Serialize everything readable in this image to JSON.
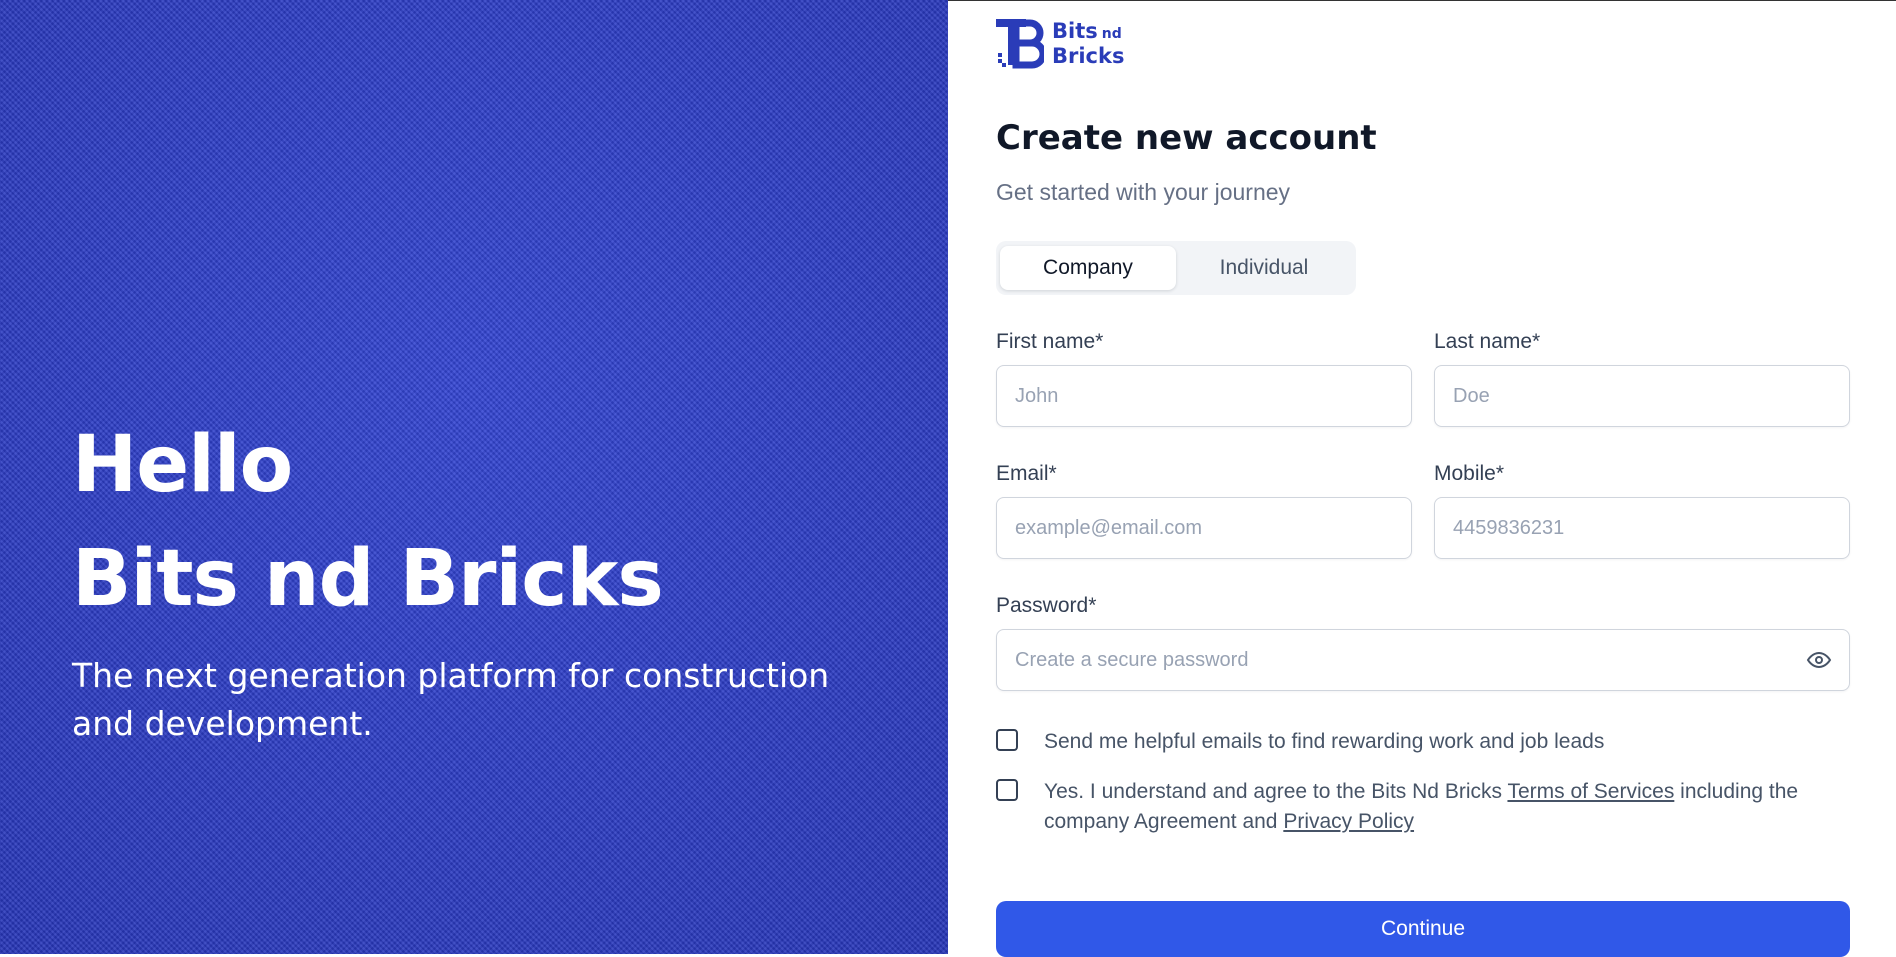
{
  "hero": {
    "title_line1": "Hello",
    "title_line2": "Bits nd Bricks",
    "subtitle": "The next generation platform for construction and development."
  },
  "logo": {
    "text_line1": "Bits",
    "text_nd": "nd",
    "text_line2": "Bricks",
    "icon": "bits-nd-bricks-logo"
  },
  "form": {
    "title": "Create new account",
    "subtitle": "Get started with your journey",
    "tabs": [
      {
        "label": "Company",
        "selected": true
      },
      {
        "label": "Individual",
        "selected": false
      }
    ],
    "first_name": {
      "label": "First name*",
      "placeholder": "John"
    },
    "last_name": {
      "label": "Last name*",
      "placeholder": "Doe"
    },
    "email": {
      "label": "Email*",
      "placeholder": "example@email.com"
    },
    "mobile": {
      "label": "Mobile*",
      "placeholder": "4459836231"
    },
    "password": {
      "label": "Password*",
      "placeholder": "Create a secure password",
      "toggle_icon": "eye-icon"
    },
    "opt_in": {
      "text": "Send me helpful emails to find rewarding work and job leads",
      "checked": false
    },
    "terms": {
      "text_before": "Yes. I understand and agree to the Bits Nd Bricks ",
      "terms_link": "Terms of Services",
      "text_middle": " including the company Agreement and ",
      "privacy_link": "Privacy Policy",
      "checked": false
    },
    "continue_label": "Continue"
  },
  "colors": {
    "hero_bg": "#2a3cc3",
    "primary": "#3058e8",
    "brand": "#2a3cb8"
  }
}
